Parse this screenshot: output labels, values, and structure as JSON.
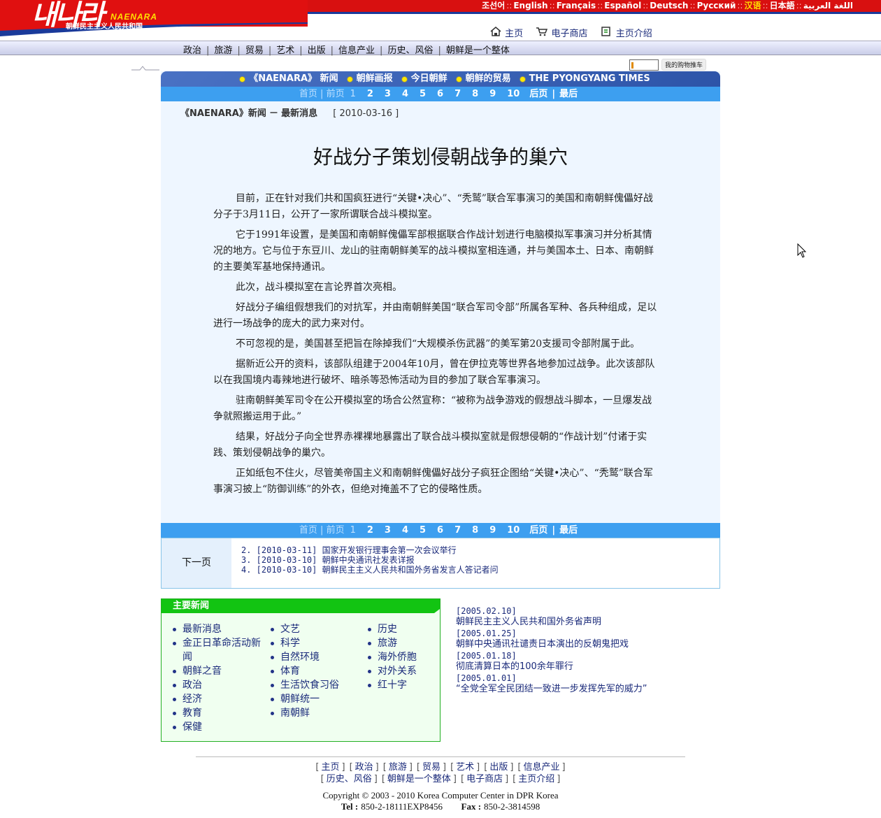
{
  "header": {
    "logo_text": "내나라",
    "logo_brand": "NAENARA",
    "logo_subtitle": "朝鲜民主主义人民共和国",
    "languages": [
      {
        "label": "조선어",
        "active": false
      },
      {
        "label": "English",
        "active": false
      },
      {
        "label": "Français",
        "active": false
      },
      {
        "label": "Español",
        "active": false
      },
      {
        "label": "Deutsch",
        "active": false
      },
      {
        "label": "Русский",
        "active": false
      },
      {
        "label": "汉语",
        "active": true
      },
      {
        "label": "日本語",
        "active": false
      },
      {
        "label": "اللغة العربية",
        "active": false
      }
    ],
    "top_links": [
      {
        "icon": "home-icon",
        "label": "主页"
      },
      {
        "icon": "cart-icon",
        "label": "电子商店"
      },
      {
        "icon": "info-icon",
        "label": "主页介绍"
      }
    ]
  },
  "nav": {
    "items": [
      "政治",
      "旅游",
      "贸易",
      "艺术",
      "出版",
      "信息产业",
      "历史、风俗",
      "朝鲜是一个整体"
    ]
  },
  "cart": {
    "label": "我的购物推车"
  },
  "section_bar": {
    "items": [
      "《NAENARA》 新闻",
      "朝鲜画报",
      "今日朝鲜",
      "朝鲜的贸易",
      "THE PYONGYANG TIMES"
    ]
  },
  "pager": {
    "first": "首页",
    "prev": "前页",
    "current": "1",
    "pages": [
      "2",
      "3",
      "4",
      "5",
      "6",
      "7",
      "8",
      "9",
      "10"
    ],
    "next": "后页",
    "last": "最后"
  },
  "breadcrumb": {
    "source": "《NAENARA》新闻",
    "dash": "－",
    "section": "最新消息",
    "date": "[ 2010-03-16 ]"
  },
  "article": {
    "title": "好战分子策划侵朝战争的巢穴",
    "paragraphs": [
      "目前，正在针对我们共和国疯狂进行“关键•决心”、“秃鹫”联合军事演习的美国和南朝鲜傀儡好战分子于3月11日，公开了一家所谓联合战斗模拟室。",
      "它于1991年设置，是美国和南朝鲜傀儡军部根据联合作战计划进行电脑模拟军事演习并分析其情况的地方。它与位于东豆川、龙山的驻南朝鲜美军的战斗模拟室相连通，并与美国本土、日本、南朝鲜的主要美军基地保持通讯。",
      "此次，战斗模拟室在言论界首次亮相。",
      "好战分子编组假想我们的对抗军，并由南朝鲜美国“联合军司令部”所属各军种、各兵种组成，足以进行一场战争的庞大的武力来对付。",
      "不可忽视的是，美国甚至把旨在除掉我们“大规模杀伤武器”的美军第20支援司令部附属于此。",
      "据新近公开的资料，该部队组建于2004年10月，曾在伊拉克等世界各地参加过战争。此次该部队以在我国境内毒辣地进行破坏、暗杀等恐怖活动为目的参加了联合军事演习。",
      "驻南朝鲜美军司令在公开模拟室的场合公然宣称：“被称为战争游戏的假想战斗脚本，一旦爆发战争就照搬运用于此。”",
      "结果，好战分子向全世界赤裸裸地暴露出了联合战斗模拟室就是假想侵朝的“作战计划”付诸于实践、策划侵朝战争的巢穴。",
      "正如纸包不住火，尽管美帝国主义和南朝鲜傀儡好战分子疯狂企图给“关键•决心”、“秃鹫”联合军事演习披上“防御训练”的外衣，但绝对掩盖不了它的侵略性质。"
    ]
  },
  "next_section": {
    "label": "下一页",
    "items": [
      "2. [2010-03-11] 国家开发银行理事会第一次会议举行",
      "3. [2010-03-10] 朝鲜中央通讯社发表详报",
      "4. [2010-03-10] 朝鲜民主主义人民共和国外务省发言人答记者问"
    ]
  },
  "main_news": {
    "title": "主要新闻",
    "col1": [
      "最新消息",
      "金正日革命活动新闻",
      "朝鲜之音",
      "政治",
      "经济",
      "教育",
      "保健"
    ],
    "col2": [
      "文艺",
      "科学",
      "自然环境",
      "体育",
      "生活饮食习俗",
      "朝鲜统一",
      "南朝鲜"
    ],
    "col3": [
      "历史",
      "旅游",
      "海外侨胞",
      "对外关系",
      "红十字"
    ]
  },
  "archive": [
    {
      "date": "[2005.02.10]",
      "title": "朝鲜民主主义人民共和国外务省声明"
    },
    {
      "date": "[2005.01.25]",
      "title": "朝鲜中央通讯社谴责日本演出的反朝鬼把戏"
    },
    {
      "date": "[2005.01.18]",
      "title": "彻底清算日本的100余年罪行"
    },
    {
      "date": "[2005.01.01]",
      "title": "“全党全军全民团结一致进一步发挥先军的威力”"
    }
  ],
  "footer": {
    "row1": [
      "主页",
      "政治",
      "旅游",
      "贸易",
      "艺术",
      "出版",
      "信息产业"
    ],
    "row2": [
      "历史、风俗",
      "朝鲜是一个整体",
      "电子商店",
      "主页介绍"
    ],
    "copyright": "Copyright © 2003 - 2010 Korea Computer Center in DPR Korea",
    "tel_label": "Tel :",
    "tel": "850-2-18111EXP8456",
    "fax_label": "Fax :",
    "fax": "850-2-3814598"
  },
  "colors": {
    "header_red": "#e01010",
    "header_blue": "#1a3a9a",
    "section_bar": "#2d54a8",
    "pager_blue": "#3d9ff0",
    "article_bg": "#eef6ff",
    "news_green": "#12c412"
  }
}
